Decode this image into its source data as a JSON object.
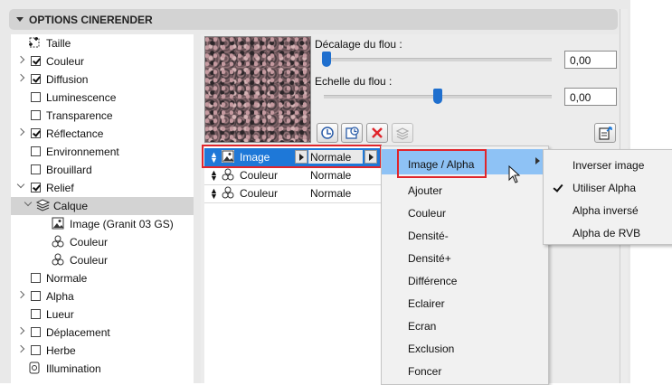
{
  "panel": {
    "title": "OPTIONS CINERENDER"
  },
  "tree": [
    {
      "label": "Taille",
      "twisty": "none",
      "check": "none",
      "icon": "resize-icon"
    },
    {
      "label": "Couleur",
      "twisty": "right",
      "check": "checked"
    },
    {
      "label": "Diffusion",
      "twisty": "right",
      "check": "checked"
    },
    {
      "label": "Luminescence",
      "twisty": "none",
      "check": "unchecked"
    },
    {
      "label": "Transparence",
      "twisty": "none",
      "check": "unchecked"
    },
    {
      "label": "Réflectance",
      "twisty": "right",
      "check": "checked"
    },
    {
      "label": "Environnement",
      "twisty": "none",
      "check": "unchecked"
    },
    {
      "label": "Brouillard",
      "twisty": "none",
      "check": "unchecked"
    },
    {
      "label": "Relief",
      "twisty": "down",
      "check": "checked"
    },
    {
      "label": "Calque",
      "twisty": "down",
      "check": "none",
      "icon": "layers-icon",
      "selected": true
    },
    {
      "label": "Image (Granit 03 GS)",
      "twisty": "none",
      "check": "none",
      "icon": "image-icon"
    },
    {
      "label": "Couleur",
      "twisty": "none",
      "check": "none",
      "icon": "color-icon"
    },
    {
      "label": "Couleur",
      "twisty": "none",
      "check": "none",
      "icon": "color-icon"
    },
    {
      "label": "Normale",
      "twisty": "none",
      "check": "unchecked"
    },
    {
      "label": "Alpha",
      "twisty": "right",
      "check": "unchecked"
    },
    {
      "label": "Lueur",
      "twisty": "none",
      "check": "unchecked"
    },
    {
      "label": "Déplacement",
      "twisty": "right",
      "check": "unchecked"
    },
    {
      "label": "Herbe",
      "twisty": "right",
      "check": "unchecked"
    },
    {
      "label": "Illumination",
      "twisty": "none",
      "check": "none",
      "icon": "illumination-icon"
    }
  ],
  "blur": {
    "offset_label": "Décalage du flou :",
    "offset_value": "0,00",
    "offset_level": 0.0,
    "scale_label": "Echelle du flou :",
    "scale_value": "0,00",
    "scale_level": 0.5
  },
  "layers": [
    {
      "name": "Image",
      "mode": "Normale",
      "selected": true,
      "icon": "image-icon"
    },
    {
      "name": "Couleur",
      "mode": "Normale",
      "selected": false,
      "icon": "color-icon"
    },
    {
      "name": "Couleur",
      "mode": "Normale",
      "selected": false,
      "icon": "color-icon"
    }
  ],
  "blend_menu": [
    "Image / Alpha",
    "Ajouter",
    "Couleur",
    "Densité-",
    "Densité+",
    "Différence",
    "Eclairer",
    "Ecran",
    "Exclusion",
    "Foncer"
  ],
  "alpha_submenu": [
    {
      "label": "Inverser image",
      "checked": false
    },
    {
      "label": "Utiliser Alpha",
      "checked": true
    },
    {
      "label": "Alpha inversé",
      "checked": false
    },
    {
      "label": "Alpha de RVB",
      "checked": false
    }
  ],
  "colors": {
    "accent": "#1e78d8",
    "highlight": "#8ec2f5",
    "annotation": "#e0252b",
    "delete": "#e0252b"
  }
}
